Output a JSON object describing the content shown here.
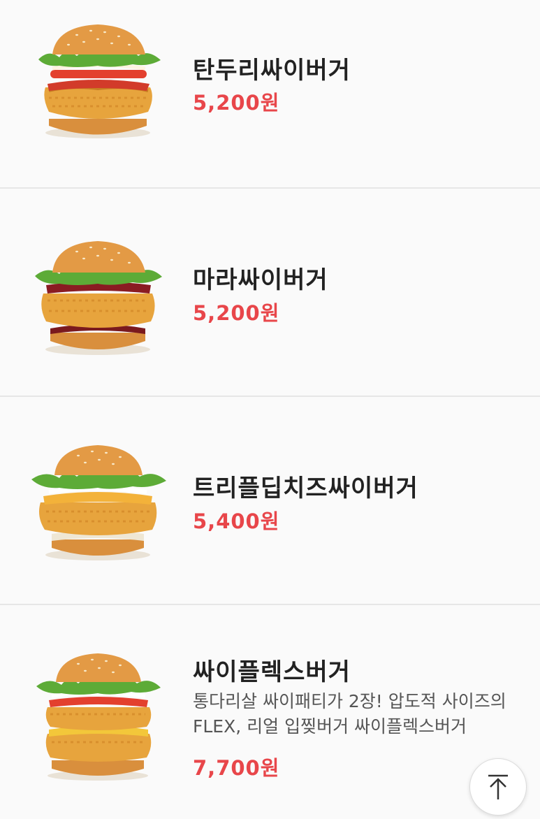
{
  "menu": {
    "items": [
      {
        "name": "탄두리싸이버거",
        "price": "5,200원",
        "description": ""
      },
      {
        "name": "마라싸이버거",
        "price": "5,200원",
        "description": ""
      },
      {
        "name": "트리플딥치즈싸이버거",
        "price": "5,400원",
        "description": ""
      },
      {
        "name": "싸이플렉스버거",
        "price": "7,700원",
        "description": "통다리살 싸이패티가 2장! 압도적 사이즈의 FLEX, 리얼 입찢버거 싸이플렉스버거"
      }
    ]
  },
  "scroll_top_button": {
    "icon": "arrow-up-to-top-icon"
  },
  "colors": {
    "price": "#e8464a",
    "name": "#222222",
    "divider": "#e6e6e6",
    "background": "#fafafa"
  }
}
